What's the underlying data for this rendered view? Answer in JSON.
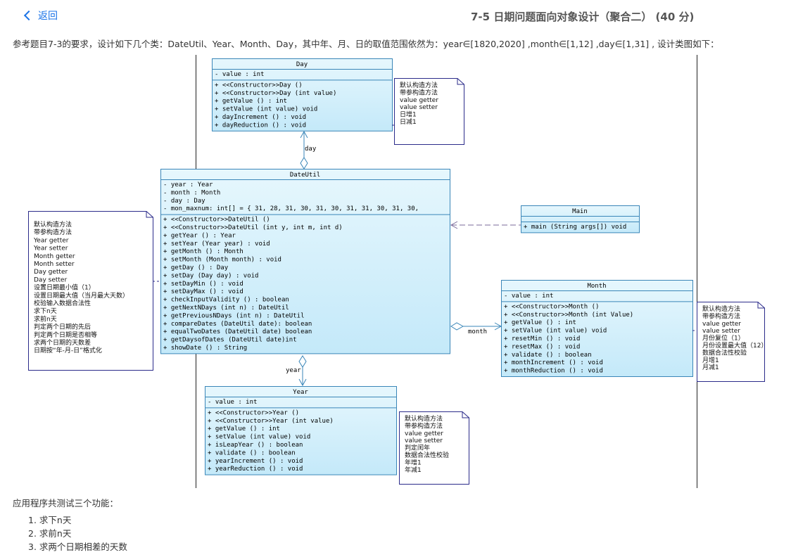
{
  "nav": {
    "back_label": "返回"
  },
  "page": {
    "title": "7-5 日期问题面向对象设计（聚合二） (40 分)",
    "intro": "参考题目7-3的要求，设计如下几个类：DateUtil、Year、Month、Day，其中年、月、日的取值范围依然为：year∈[1820,2020] ,month∈[1,12] ,day∈[1,31] , 设计类图如下：",
    "footer_label": "应用程序共测试三个功能：",
    "functions": [
      "1. 求下n天",
      "2. 求前n天",
      "3. 求两个日期相差的天数"
    ]
  },
  "diagram": {
    "classes": {
      "day": {
        "name": "Day",
        "attributes": [
          "-  value : int"
        ],
        "methods": [
          "+  <<Constructor>>Day ()",
          "+  <<Constructor>>Day (int value)",
          "+                 getValue ()         : int",
          "+                 setValue (int value) void",
          "+                 dayIncrement ()     : void",
          "+                 dayReduction ()     : void"
        ]
      },
      "dateutil": {
        "name": "DateUtil",
        "attributes": [
          "-  year       : Year",
          "-  month      : Month",
          "-  day        : Day",
          "-  mon_maxnum: int[] = { 31, 28, 31, 30, 31, 30, 31, 31, 30, 31, 30,"
        ],
        "methods": [
          "+  <<Constructor>>DateUtil ()",
          "+  <<Constructor>>DateUtil (int y, int m, int d)",
          "+                 getYear ()                  : Year",
          "+                 setYear (Year year)          : void",
          "+                 getMonth ()                  : Month",
          "+                 setMonth (Month month)       : void",
          "+                 getDay ()                    : Day",
          "+                 setDay (Day day)             : void",
          "+                 setDayMin ()                 : void",
          "+                 setDayMax ()                 : void",
          "+                 checkInputValidity ()        : boolean",
          "+                 getNextNDays (int n)         : DateUtil",
          "+                 getPreviousNDays (int n)     : DateUtil",
          "+                 compareDates (DateUtil date): boolean",
          "+                 equalTwoDates (DateUtil date) boolean",
          "+                 getDaysofDates (DateUtil date)int",
          "+                 showDate ()                  : String"
        ]
      },
      "main": {
        "name": "Main",
        "attributes": [],
        "methods": [
          "+  main (String args[]) void"
        ]
      },
      "month": {
        "name": "Month",
        "attributes": [
          "-  value : int"
        ],
        "methods": [
          "+  <<Constructor>>Month ()",
          "+  <<Constructor>>Month (int Value)",
          "+                 getValue ()          : int",
          "+                 setValue (int value) void",
          "+                 resetMin ()          : void",
          "+                 resetMax ()          : void",
          "+                 validate ()          : boolean",
          "+                 monthIncrement ()    : void",
          "+                 monthReduction ()    : void"
        ]
      },
      "year": {
        "name": "Year",
        "attributes": [
          "-  value : int"
        ],
        "methods": [
          "+  <<Constructor>>Year ()",
          "+  <<Constructor>>Year (int value)",
          "+                 getValue ()          : int",
          "+                 setValue (int value) void",
          "+                 isLeapYear ()        : boolean",
          "+                 validate ()          : boolean",
          "+                 yearIncrement ()     : void",
          "+                 yearReduction ()     : void"
        ]
      }
    },
    "associations": {
      "day": "day",
      "month": "month",
      "year": "year"
    },
    "notes": {
      "day": [
        "默认构造方法",
        "带参构造方法",
        "value getter",
        "value setter",
        "日增1",
        "日减1"
      ],
      "dateutil": [
        "默认构造方法",
        "带参构造方法",
        "Year getter",
        "Year setter",
        "Month getter",
        "Month setter",
        "Day getter",
        "Day setter",
        "设置日期最小值（1）",
        "设置日期最大值（当月最大天数）",
        "校验输入数据合法性",
        "求下n天",
        "求前n天",
        "判定两个日期的先后",
        "判定两个日期是否相等",
        "求两个日期的天数差",
        "日期按“年-月-日”格式化"
      ],
      "month": [
        "默认构造方法",
        "带参构造方法",
        "value getter",
        "value setter",
        "月份复位（1）",
        "月份设置最大值（12）",
        "数据合法性校验",
        "月增1",
        "月减1"
      ],
      "year": [
        "默认构造方法",
        "带参构造方法",
        "value getter",
        "value setter",
        "判定闰年",
        "数据合法性校验",
        "年增1",
        "年减1"
      ]
    },
    "colors": {
      "class_fill": "#cfeefb",
      "class_border": "#3a86b8",
      "note_border": "#2b2b8a",
      "link": "#1a73e8"
    }
  }
}
